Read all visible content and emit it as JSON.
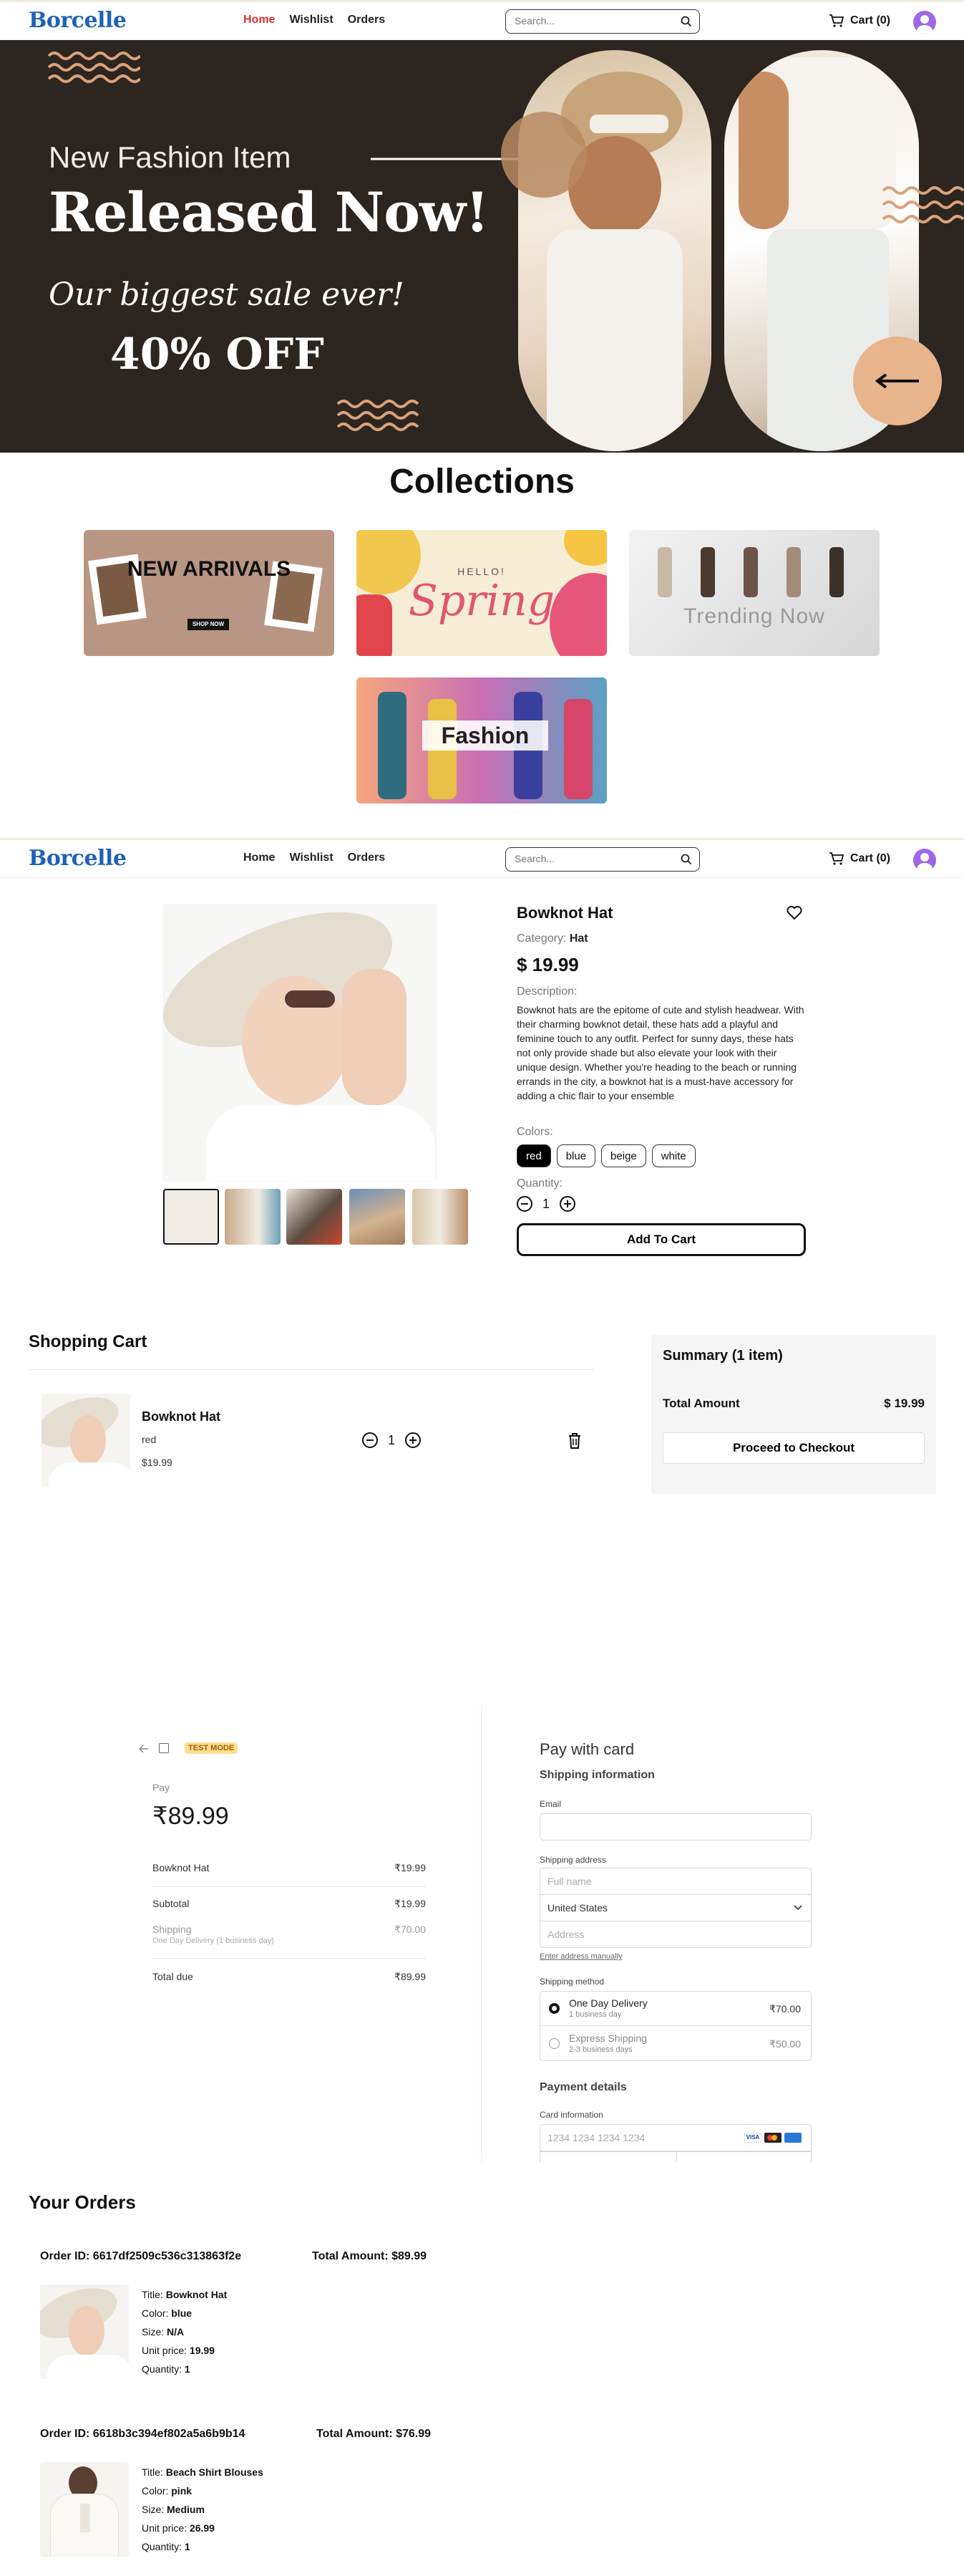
{
  "nav": {
    "brand": "Borcelle",
    "links": [
      "Home",
      "Wishlist",
      "Orders"
    ],
    "search_placeholder": "Search...",
    "cart_label": "Cart (0)"
  },
  "hero": {
    "subtitle": "New Fashion Item",
    "title": "Released Now!",
    "tagline": "Our biggest sale ever!",
    "offer": "40% OFF"
  },
  "collections": {
    "title": "Collections",
    "tiles": [
      {
        "name": "New Arrivals",
        "text": "NEW ARRIVALS",
        "button": "SHOP NOW"
      },
      {
        "name": "Spring",
        "text_small": "HELLO!",
        "text": "Spring"
      },
      {
        "name": "Trending Now",
        "text": "Trending Now"
      },
      {
        "name": "Fashion",
        "text": "Fashion"
      }
    ]
  },
  "product": {
    "title": "Bowknot Hat",
    "category_label": "Category:",
    "category": "Hat",
    "price": "$ 19.99",
    "description_label": "Description:",
    "description": "Bowknot hats are the epitome of cute and stylish headwear. With their charming bowknot detail, these hats add a playful and feminine touch to any outfit. Perfect for sunny days, these hats not only provide shade but also elevate your look with their unique design. Whether you're heading to the beach or running errands in the city, a bowknot hat is a must-have accessory for adding a chic flair to your ensemble",
    "colors_label": "Colors:",
    "colors": [
      "red",
      "blue",
      "beige",
      "white"
    ],
    "selected_color": "red",
    "quantity_label": "Quantity:",
    "quantity": "1",
    "add_to_cart": "Add To Cart"
  },
  "cart": {
    "title": "Shopping Cart",
    "item": {
      "name": "Bowknot Hat",
      "color": "red",
      "price": "$19.99",
      "quantity": "1"
    },
    "summary": {
      "title": "Summary (1 item)",
      "total_label": "Total Amount",
      "total": "$ 19.99",
      "checkout": "Proceed to Checkout"
    }
  },
  "checkout": {
    "badge": "TEST MODE",
    "pay_label": "Pay",
    "amount": "₹89.99",
    "item_name": "Bowknot Hat",
    "item_price": "₹19.99",
    "subtotal_label": "Subtotal",
    "subtotal": "₹19.99",
    "shipping_label": "Shipping",
    "shipping_sub": "One Day Delivery (1 business day)",
    "shipping": "₹70.00",
    "total_label": "Total due",
    "total": "₹89.99",
    "form_title": "Pay with card",
    "shipping_info": "Shipping information",
    "email_label": "Email",
    "address_label": "Shipping address",
    "full_name_placeholder": "Full name",
    "country": "United States",
    "address_placeholder": "Address",
    "manual_link": "Enter address manually",
    "method_label": "Shipping method",
    "methods": [
      {
        "name": "One Day Delivery",
        "sub": "1 business day",
        "price": "₹70.00"
      },
      {
        "name": "Express Shipping",
        "sub": "2-3 business days",
        "price": "₹50.00"
      }
    ],
    "payment_details": "Payment details",
    "card_info_label": "Card information",
    "card_placeholder": "1234 1234 1234 1234"
  },
  "orders": {
    "title": "Your Orders",
    "list": [
      {
        "id": "Order ID: 6617df2509c536c313863f2e",
        "total": "Total Amount: $89.99",
        "title_label": "Title:",
        "title": "Bowknot Hat",
        "color_label": "Color:",
        "color": "blue",
        "size_label": "Size:",
        "size": "N/A",
        "price_label": "Unit price:",
        "price": "19.99",
        "qty_label": "Quantity:",
        "qty": "1"
      },
      {
        "id": "Order ID: 6618b3c394ef802a5a6b9b14",
        "total": "Total Amount: $76.99",
        "title_label": "Title:",
        "title": "Beach Shirt Blouses",
        "color_label": "Color:",
        "color": "pink",
        "size_label": "Size:",
        "size": "Medium",
        "price_label": "Unit price:",
        "price": "26.99",
        "qty_label": "Quantity:",
        "qty": "1"
      }
    ]
  },
  "colors": {
    "brand": "#1f62b4",
    "nav_active": "#e02f2f",
    "hero_bg": "#2c2520",
    "accent": "#e7b48c",
    "avatar": "#9d67e8"
  },
  "icons": [
    "search-icon",
    "cart-icon",
    "user-avatar-icon",
    "arrow-right-icon",
    "arrow-left-icon",
    "heart-icon",
    "minus-icon",
    "plus-icon",
    "trash-icon",
    "back-arrow-icon",
    "visa-icon",
    "mastercard-icon",
    "amex-icon"
  ]
}
